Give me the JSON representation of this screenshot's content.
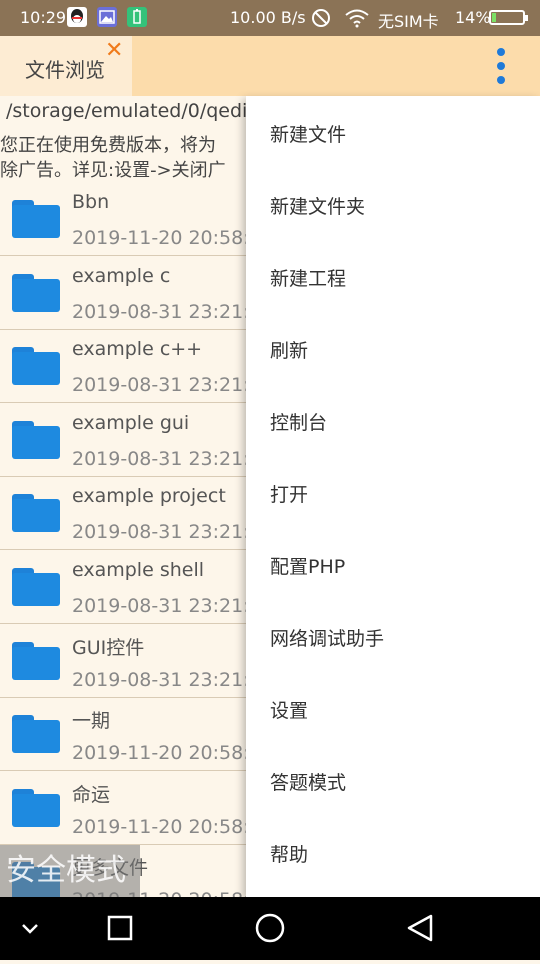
{
  "status_bar": {
    "time": "10:29",
    "speed": "10.00 B/s",
    "sim": "无SIM卡",
    "battery_pct": "14%",
    "battery_level": 0.14,
    "icons": [
      "qq-icon",
      "gallery-icon",
      "battery-app-icon",
      "no-disturb-icon",
      "wifi-icon",
      "battery-icon"
    ]
  },
  "app_bar": {
    "tab_label": "文件浏览",
    "tab_close": "✕",
    "overflow_icon": "more-vert-icon"
  },
  "path": "/storage/emulated/0/qedi",
  "notice": [
    "您正在使用免费版本，将为",
    "除广告。详见:设置->关闭广"
  ],
  "files": [
    {
      "name": "Bbn",
      "date": "2019-11-20 20:58:5"
    },
    {
      "name": "example c",
      "date": "2019-08-31 23:21:1"
    },
    {
      "name": "example c++",
      "date": "2019-08-31 23:21:1"
    },
    {
      "name": "example gui",
      "date": "2019-08-31 23:21:2"
    },
    {
      "name": "example project",
      "date": "2019-08-31 23:21:2"
    },
    {
      "name": "example shell",
      "date": "2019-08-31 23:21:2"
    },
    {
      "name": "GUI控件",
      "date": "2019-08-31 23:21:1"
    },
    {
      "name": "一期",
      "date": "2019-11-20 20:58:5"
    },
    {
      "name": "命运",
      "date": "2019-11-20 20:58:5"
    },
    {
      "name": "更多文件",
      "date": "2019-11-20 20:58:5"
    }
  ],
  "safe_mode": "安全模式",
  "menu": [
    "新建文件",
    "新建文件夹",
    "新建工程",
    "刷新",
    "控制台",
    "打开",
    "配置PHP",
    "网络调试助手",
    "设置",
    "答题模式",
    "帮助"
  ],
  "nav": [
    "back-chevron-icon",
    "recents-square-icon",
    "home-circle-icon",
    "back-triangle-icon"
  ],
  "colors": {
    "status_bar": "#8b7356",
    "app_bar": "#fcdcab",
    "accent": "#1e8ae0",
    "close": "#f07a1a"
  }
}
